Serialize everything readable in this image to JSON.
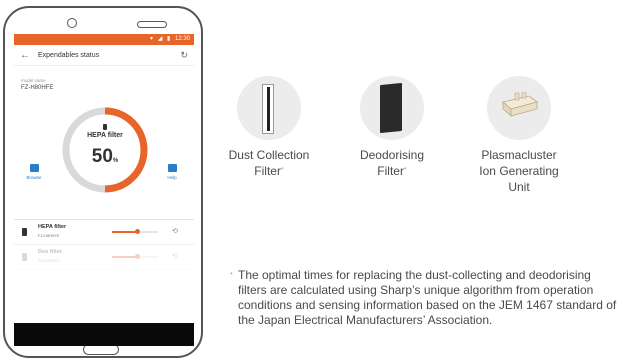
{
  "phone": {
    "status_bar": {
      "time": "12:30"
    },
    "app_bar": {
      "title": "Expendables status"
    },
    "model": {
      "label": "model name",
      "name": "FZ-H80HFE"
    },
    "gauge": {
      "label": "HEPA filter",
      "value": "50",
      "unit": "%",
      "fraction": 0.5
    },
    "browse_label": "Browse",
    "help_label": "Help",
    "consumables": [
      {
        "name": "HEPA filter",
        "model": "FZ-H80HFE",
        "level": 0.55
      },
      {
        "name": "Deo filter",
        "model": "FZ-H80DFE",
        "level": 0.55
      }
    ]
  },
  "products": [
    {
      "name": "Dust Collection Filter",
      "line1": "Dust Collection",
      "line2": "Filter",
      "asterisk": "*"
    },
    {
      "name": "Deodorising Filter",
      "line1": "Deodorising",
      "line2": "Filter",
      "asterisk": "*"
    },
    {
      "name": "Plasmacluster Ion Generating Unit",
      "line1": "Plasmacluster",
      "line2": "Ion Generating",
      "line3": "Unit"
    }
  ],
  "footnote": {
    "marker": "*",
    "text": "The optimal times for replacing the dust-collecting and deodorising filters are calculated using Sharp’s unique algorithm from operation conditions and sensing information based on the JEM 1467 standard of the Japan Electrical Manufacturers’ Association."
  },
  "colors": {
    "accent": "#e8652a",
    "link": "#2a7dc9",
    "asterisk": "#3fc1b7",
    "disc": "#ececec"
  }
}
